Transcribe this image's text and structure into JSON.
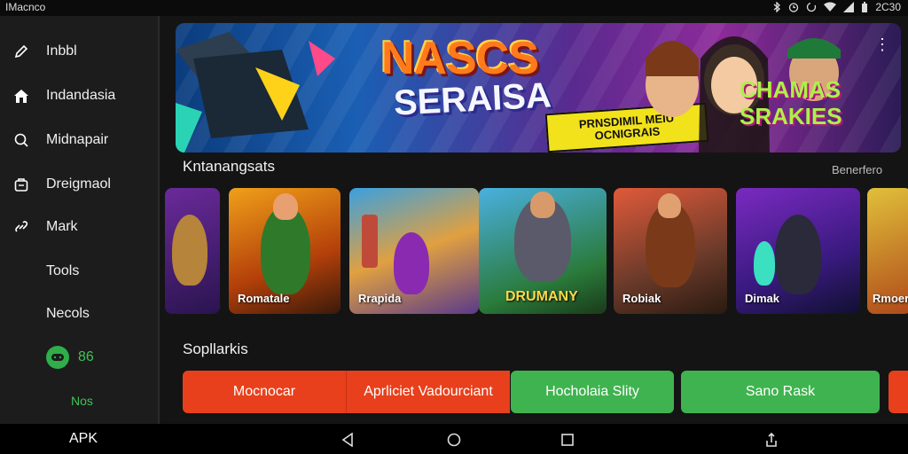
{
  "status_bar": {
    "app_name": "IMacnco",
    "time": "2C30",
    "icons": [
      "bluetooth-icon",
      "alarm-icon",
      "sync-icon",
      "wifi-icon",
      "signal-icon",
      "battery-icon"
    ]
  },
  "sidebar": {
    "items": [
      {
        "label": "Inbbl",
        "icon": "pencil-icon"
      },
      {
        "label": "Indandasia",
        "icon": "home-icon"
      },
      {
        "label": "Midnapair",
        "icon": "search-icon"
      },
      {
        "label": "Dreigmaol",
        "icon": "bag-icon"
      },
      {
        "label": "Mark",
        "icon": "link-icon"
      },
      {
        "label": "Tools",
        "icon": ""
      },
      {
        "label": "Necols",
        "icon": ""
      },
      {
        "label": "86",
        "icon": "controller-icon"
      },
      {
        "label": "Nos",
        "icon": ""
      }
    ]
  },
  "hero": {
    "title_line1": "NASCS",
    "title_line2": "SERAISA",
    "tag_text": "PRNSDIMIL MEIU OCNIGRAIS",
    "brand_line1": "CHAMAS",
    "brand_line2": "SRAKIES"
  },
  "section1": {
    "title": "Kntanangsats",
    "link": "Benerfero"
  },
  "cards": [
    {
      "label": ""
    },
    {
      "label": "Romatale"
    },
    {
      "label": "Rrapida"
    },
    {
      "label": "DRUMANY"
    },
    {
      "label": "Robiak"
    },
    {
      "label": "Dimak"
    },
    {
      "label": "Rmoer"
    }
  ],
  "section2": {
    "title": "Sopllarkis"
  },
  "buttons": [
    {
      "label": "Mocnocar"
    },
    {
      "label": "Aprliciet Vadourciant"
    },
    {
      "label": "Hocholaia Slity"
    },
    {
      "label": "Sano Rask"
    }
  ],
  "colors": {
    "red": "#e8401c",
    "green": "#3fb34f",
    "accent_green": "#2fae4a",
    "background": "#121212"
  },
  "nav_bar": {
    "label": "APK"
  }
}
